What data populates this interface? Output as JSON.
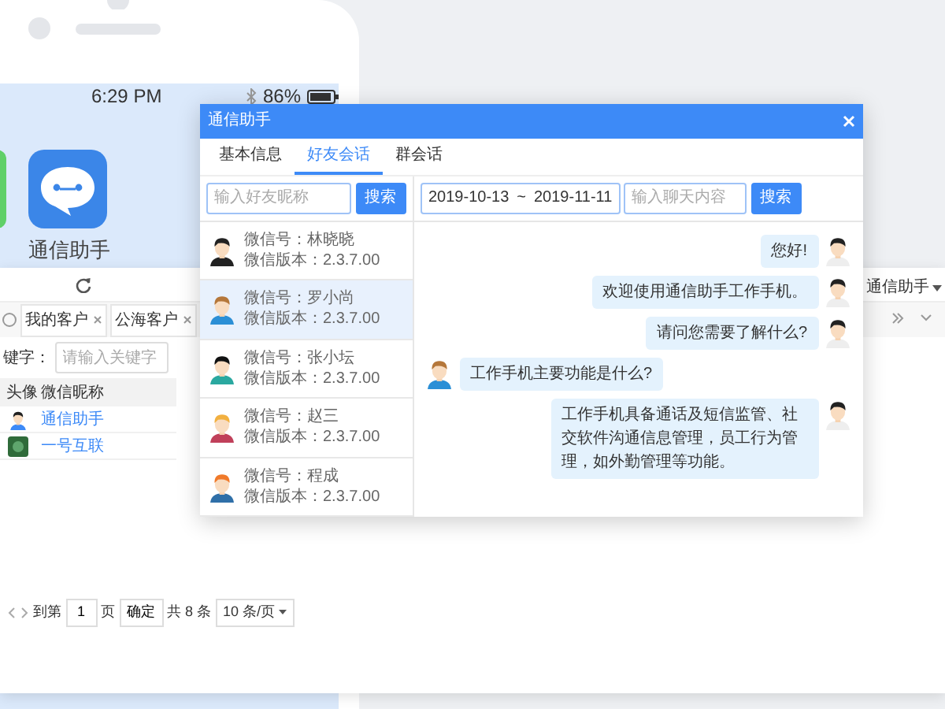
{
  "phone": {
    "time": "6:29 PM",
    "battery": "86%",
    "app_label": "通信助手"
  },
  "admin_window": {
    "tabs": [
      "我的客户",
      "公海客户"
    ],
    "filter": {
      "label": "键字：",
      "placeholder": "请输入关键字"
    },
    "table": {
      "columns": [
        "头像",
        "微信昵称"
      ],
      "rows": [
        {
          "nickname": "通信助手"
        },
        {
          "nickname": "一号互联"
        }
      ]
    },
    "pagination": {
      "goto_label": "到第",
      "page": "1",
      "page_suffix": "页",
      "confirm": "确定",
      "total": "共 8 条",
      "page_size": "10 条/页"
    },
    "user_menu": "通信助手"
  },
  "dialog": {
    "title": "通信助手",
    "tabs": [
      {
        "label": "基本信息",
        "selected": false
      },
      {
        "label": "好友会话",
        "selected": true
      },
      {
        "label": "群会话",
        "selected": false
      }
    ],
    "friend_search": {
      "placeholder": "输入好友昵称",
      "button": "搜索"
    },
    "contacts": [
      {
        "wechat_id": "微信号：林晓晓",
        "version": "微信版本：2.3.7.00",
        "selected": false
      },
      {
        "wechat_id": "微信号：罗小尚",
        "version": "微信版本：2.3.7.00",
        "selected": true
      },
      {
        "wechat_id": "微信号：张小坛",
        "version": "微信版本：2.3.7.00",
        "selected": false
      },
      {
        "wechat_id": "微信号：赵三",
        "version": "微信版本：2.3.7.00",
        "selected": false
      },
      {
        "wechat_id": "微信号：程成",
        "version": "微信版本：2.3.7.00",
        "selected": false
      }
    ],
    "date_from": "2019-10-13",
    "date_separator": "~",
    "date_to": "2019-11-11",
    "chat_search": {
      "placeholder": "输入聊天内容",
      "button": "搜索"
    },
    "messages": [
      {
        "kind": "outgoing",
        "text": "您好!"
      },
      {
        "kind": "outgoing",
        "text": "欢迎使用通信助手工作手机。"
      },
      {
        "kind": "outgoing",
        "text": "请问您需要了解什么?"
      },
      {
        "kind": "incoming",
        "text": "工作手机主要功能是什么?"
      },
      {
        "kind": "outgoing",
        "text": "工作手机具备通话及短信监管、社交软件沟通信息管理，员工行为管理，如外勤管理等功能。"
      }
    ]
  }
}
